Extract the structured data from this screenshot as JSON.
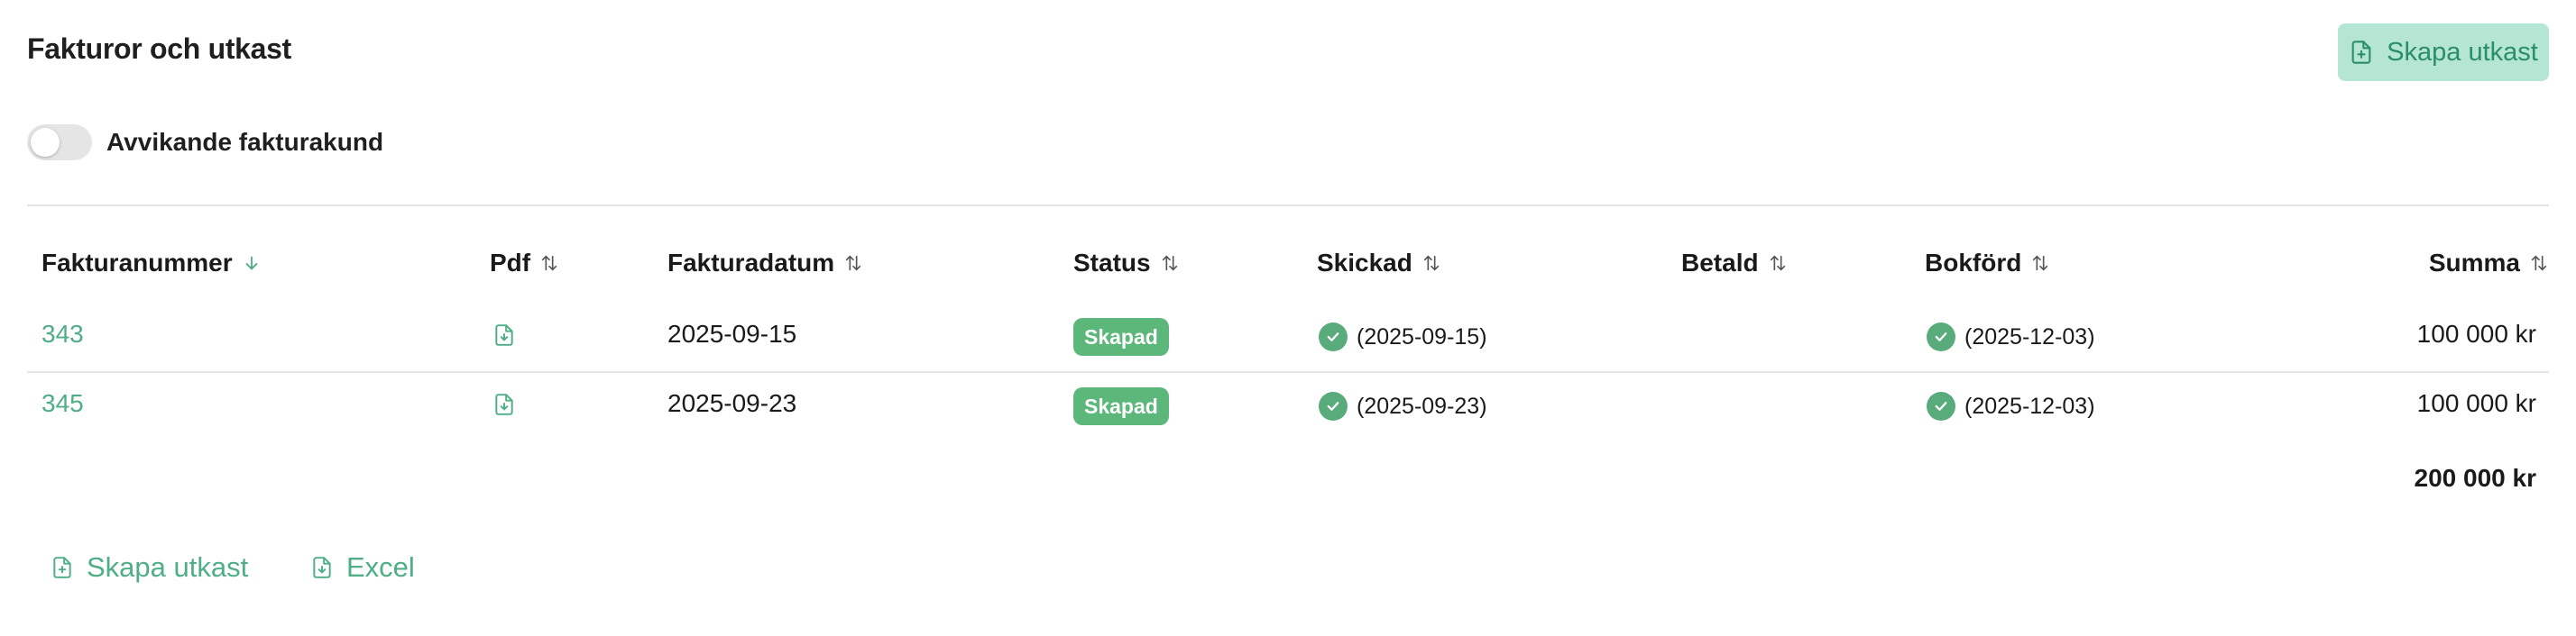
{
  "header": {
    "title": "Fakturor och utkast",
    "create_draft_label": "Skapa utkast"
  },
  "toggle": {
    "label": "Avvikande fakturakund",
    "checked": false
  },
  "table": {
    "columns": [
      {
        "key": "number",
        "label": "Fakturanummer",
        "sort": "desc"
      },
      {
        "key": "pdf",
        "label": "Pdf",
        "sort": "none"
      },
      {
        "key": "date",
        "label": "Fakturadatum",
        "sort": "none"
      },
      {
        "key": "status",
        "label": "Status",
        "sort": "none"
      },
      {
        "key": "sent",
        "label": "Skickad",
        "sort": "none"
      },
      {
        "key": "paid",
        "label": "Betald",
        "sort": "none"
      },
      {
        "key": "booked",
        "label": "Bokförd",
        "sort": "none"
      },
      {
        "key": "sum",
        "label": "Summa",
        "sort": "none"
      }
    ],
    "rows": [
      {
        "number": "343",
        "date": "2025-09-15",
        "status": "Skapad",
        "sent": "(2025-09-15)",
        "paid": "",
        "booked": "(2025-12-03)",
        "sum": "100 000 kr"
      },
      {
        "number": "345",
        "date": "2025-09-23",
        "status": "Skapad",
        "sent": "(2025-09-23)",
        "paid": "",
        "booked": "(2025-12-03)",
        "sum": "100 000 kr"
      }
    ],
    "total": "200 000 kr"
  },
  "footer": {
    "create_draft_label": "Skapa utkast",
    "excel_label": "Excel"
  },
  "colors": {
    "accent": "#4fae86",
    "badge": "#5cb87a",
    "button_bg": "#b5e6d3"
  },
  "icons": {
    "create": "file-plus-icon",
    "pdf": "file-download-icon",
    "check": "check-circle-icon",
    "sort": "sort-arrows-icon",
    "sort_desc": "arrow-down-icon"
  }
}
